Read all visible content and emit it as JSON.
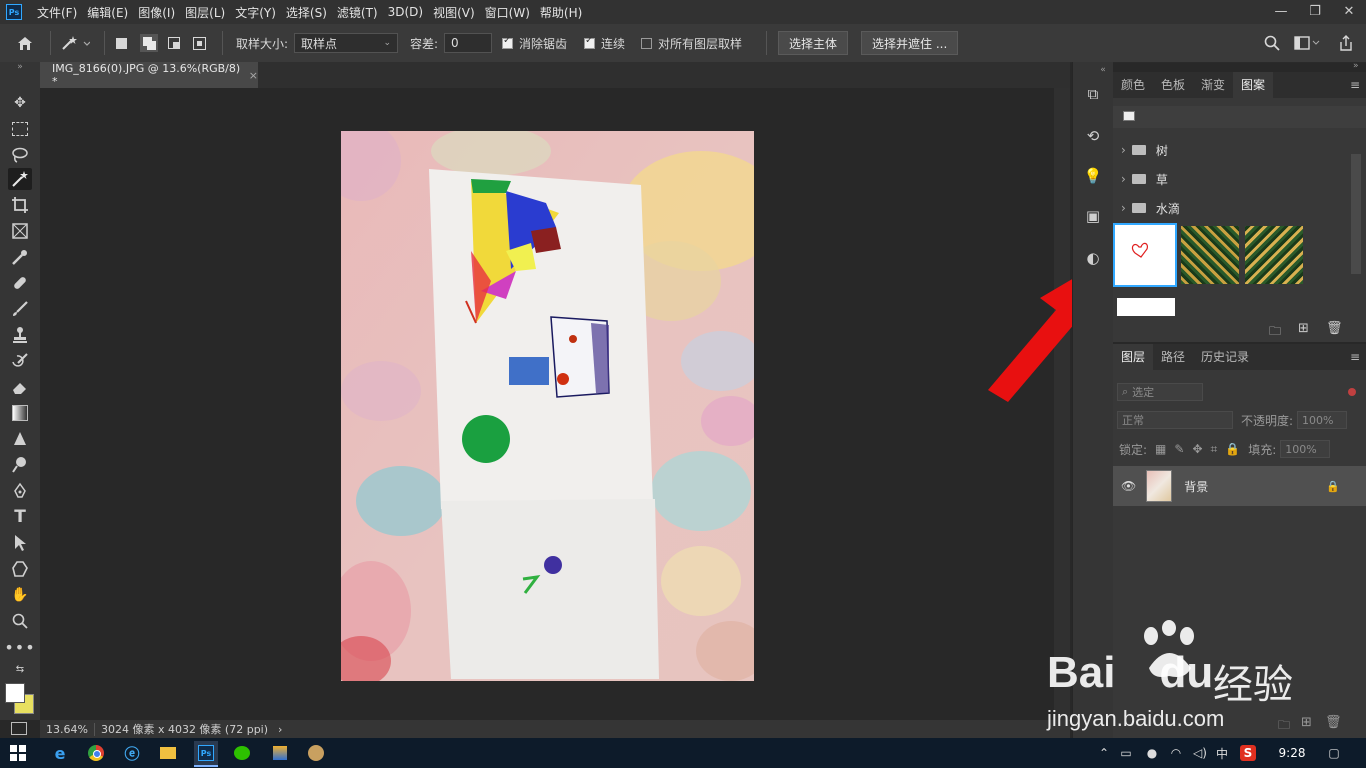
{
  "menubar": {
    "items": [
      "文件(F)",
      "编辑(E)",
      "图像(I)",
      "图层(L)",
      "文字(Y)",
      "选择(S)",
      "滤镜(T)",
      "3D(D)",
      "视图(V)",
      "窗口(W)",
      "帮助(H)"
    ],
    "logo": "Ps"
  },
  "options": {
    "sample_size_label": "取样大小:",
    "sample_size_value": "取样点",
    "tolerance_label": "容差:",
    "tolerance_value": "0",
    "antialias_label": "消除锯齿",
    "contiguous_label": "连续",
    "all_layers_label": "对所有图层取样",
    "select_subject": "选择主体",
    "select_and_mask": "选择并遮住 ..."
  },
  "document": {
    "tab_title": "IMG_8166(0).JPG @ 13.6%(RGB/8) *",
    "close": "×"
  },
  "status": {
    "zoom": "13.64%",
    "doc_info": "3024 像素 x 4032 像素 (72 ppi)",
    "arrow": "›"
  },
  "pattern_panel": {
    "tabs": [
      "颜色",
      "色板",
      "渐变",
      "图案"
    ],
    "active_tab": "图案",
    "folders": [
      "树",
      "草",
      "水滴"
    ]
  },
  "layers_panel": {
    "tabs": [
      "图层",
      "路径",
      "历史记录"
    ],
    "filter_placeholder": "选定",
    "blend_mode": "正常",
    "opacity_label": "不透明度:",
    "opacity_value": "100%",
    "lock_label": "锁定:",
    "fill_label": "填充:",
    "fill_value": "100%",
    "layer_name": "背景"
  },
  "taskbar": {
    "time": "9:28",
    "ime": "中",
    "ps": "Ps"
  },
  "watermark": {
    "brand": "Bai",
    "brand2": "du",
    "cn": "经验",
    "url": "jingyan.baidu.com"
  },
  "colors": {
    "accent": "#31a8ff",
    "arrow": "#e81010",
    "foreground_swatch": "#ffffff",
    "background_swatch": "#e8e060"
  }
}
